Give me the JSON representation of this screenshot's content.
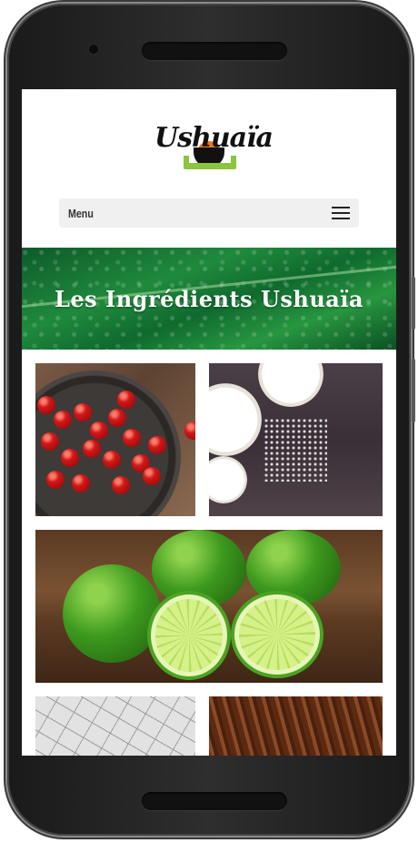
{
  "brand": {
    "logo_text": "Ushuaïa"
  },
  "nav": {
    "menu_label": "Menu",
    "menu_icon": "hamburger-icon"
  },
  "hero": {
    "title": "Les Ingrédients Ushuaïa"
  },
  "gallery": {
    "images": [
      "acerola-cherries",
      "coconut",
      "limes",
      "clay",
      "bark"
    ]
  }
}
